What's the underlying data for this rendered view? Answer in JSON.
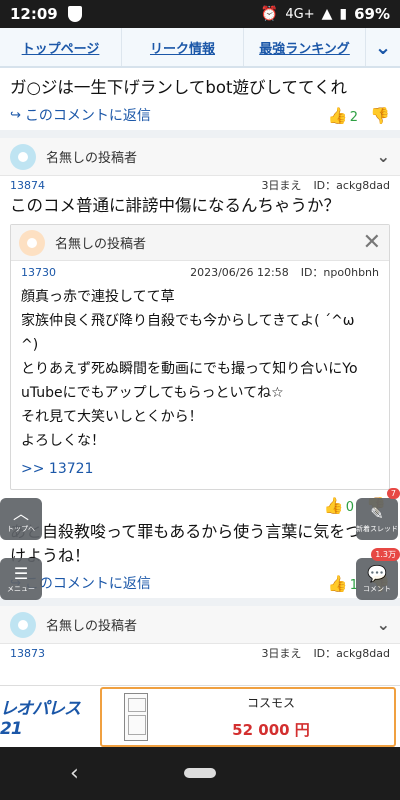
{
  "status_bar": {
    "time": "12:09",
    "network": "4G+",
    "battery": "69%"
  },
  "nav": {
    "tabs": [
      "トップページ",
      "リーク情報",
      "最強ランキング"
    ]
  },
  "comments": {
    "first_tail": {
      "text": "ガ○ジは一生下げランしてbot遊びしててくれ",
      "reply_label": "このコメントに返信",
      "up_votes": "2"
    },
    "second": {
      "poster": "名無しの投稿者",
      "number": "13874",
      "time": "3日まえ",
      "id": "ID：ackg8dad",
      "text": "このコメ普通に誹謗中傷になるんちゃうか？",
      "quote": {
        "poster": "名無しの投稿者",
        "number": "13730",
        "datetime": "2023/06/26 12:58",
        "id": "ID：npo0hbnh",
        "lines": [
          "顔真っ赤で連投してて草",
          "家族仲良く飛び降り自殺でも今からしてきてよ( ´^ω",
          "^)",
          "とりあえず死ぬ瞬間を動画にでも撮って知り合いにYo",
          "uTubeにでもアップしてもらっといてね☆",
          "それ見て大笑いしとくから！",
          "よろしくな！"
        ],
        "link": ">> 13721"
      },
      "up_votes": "0",
      "text2_line1": "あと自殺教唆って罪もあるから使う言葉に気をつ",
      "text2_line2": "けようね！",
      "reply_label": "このコメントに返信",
      "up_votes2": "1"
    },
    "third": {
      "poster": "名無しの投稿者",
      "number": "13873",
      "time": "3日まえ",
      "id": "ID：ackg8dad"
    }
  },
  "fabs": {
    "top_label": "トップへ",
    "menu_label": "メニュー",
    "new_thread_label": "新着スレッド",
    "new_thread_badge": "7",
    "comment_label": "コメント",
    "comment_badge": "1.3万"
  },
  "ad": {
    "logo": "レオパレス21",
    "name": "コスモス",
    "price": "52 000 円"
  }
}
